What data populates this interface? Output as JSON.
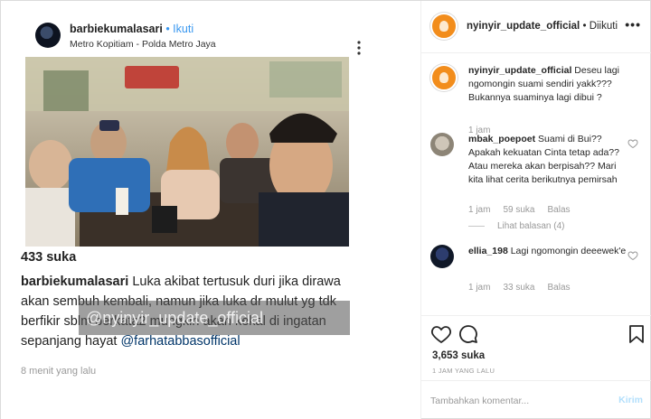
{
  "screenshot": {
    "username": "barbiekumalasari",
    "separator": " • ",
    "follow_label": "Ikuti",
    "location": "Metro Kopitiam - Polda Metro Jaya",
    "likes": "433 suka",
    "caption_user": "barbiekumalasari",
    "caption_lines": [
      " Luka akibat tertusuk duri  jika dirawa",
      "akan sembuh kembali, namun jika luka dr mulut yg tdk",
      "berfikir sblm berkata2 mungkin akan kekal di ingatan",
      "sepanjang hayat "
    ],
    "caption_mention": "@farhatabbasofficial",
    "time": "8 menit yang lalu",
    "watermark": "@nyinyir_update_official"
  },
  "header": {
    "username": "nyinyir_update_official",
    "separator": " • ",
    "status": "Diikuti",
    "more_label": "•••"
  },
  "comments": [
    {
      "user": "nyinyir_update_official",
      "text": " Deseu lagi ngomongin suami sendiri yakk??? Bukannya suaminya lagi dibui ?",
      "time": "1 jam"
    },
    {
      "user": "mbak_poepoet",
      "text": " Suami di Bui?? Apakah kekuatan Cinta tetap ada?? Atau mereka akan berpisah?? Mari kita lihat cerita berikutnya pemirsah",
      "time": "1 jam",
      "likes": "59 suka",
      "reply": "Balas",
      "view_replies": "Lihat balasan (4)"
    },
    {
      "user": "ellia_198",
      "text": " Lagi ngomongin deeewek'e",
      "time": "1 jam",
      "likes": "33 suka",
      "reply": "Balas"
    }
  ],
  "actions": {
    "likes": "3,653 suka",
    "time": "1 JAM YANG LALU"
  },
  "compose": {
    "placeholder": "Tambahkan komentar...",
    "send_label": "Kirim"
  },
  "colors": {
    "link": "#3897f0",
    "send_disabled": "#b2dffc",
    "avatar_brand": "#f28d1c"
  },
  "icons": [
    "more-icon",
    "heart-icon",
    "comment-icon",
    "bookmark-icon",
    "heart-small-icon"
  ]
}
